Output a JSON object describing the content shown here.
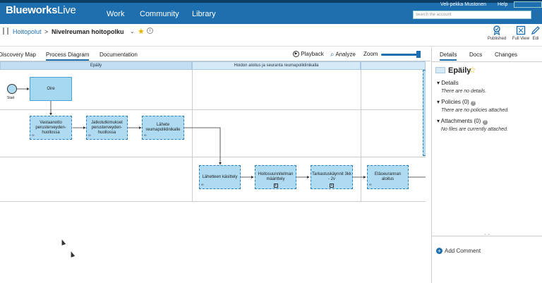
{
  "header": {
    "logo_bold": "Blueworks",
    "logo_light": "Live",
    "nav": [
      "Work",
      "Community",
      "Library"
    ],
    "user": "Veli-pekka Mustonen",
    "help": "Help",
    "search_placeholder": "search the account"
  },
  "breadcrumb": {
    "parent": "Hoitopolut",
    "separator": ">",
    "current": "Nivelreuman hoitopolku",
    "chevron": "⌄",
    "star": "★",
    "info": "i"
  },
  "toolbar_buttons": [
    {
      "label": "Published",
      "icon": "award-icon"
    },
    {
      "label": "Full View",
      "icon": "fullview-icon"
    },
    {
      "label": "Edi",
      "icon": "edit-icon"
    }
  ],
  "tabs": [
    "Discovery Map",
    "Process Diagram",
    "Documentation"
  ],
  "controls": {
    "playback": "Playback",
    "analyze": "Analyze",
    "zoom": "Zoom",
    "zoom_level": 0.95
  },
  "lanes": [
    {
      "title": "Epäily"
    },
    {
      "title": "Hoidon aloitus ja seuranta reumapoliklinikalla"
    },
    {
      "title": ""
    }
  ],
  "start_label": "Start",
  "tasks": [
    {
      "label": "Oire",
      "marker": ""
    },
    {
      "label": "Vastaanotto perusterveyden-huollossa",
      "marker": "∞"
    },
    {
      "label": "Jatkotutkimukset perusterveyden-huollossa",
      "marker": "∞"
    },
    {
      "label": "Lähete reumapoliklinikalle",
      "marker": "∞"
    },
    {
      "label": "Lähetteen käsittely",
      "marker": "∞"
    },
    {
      "label": "Hoitosuunnitelman määrittely",
      "marker": "+"
    },
    {
      "label": "Tarkastuskäynnit 3kk - 2v",
      "marker": "+"
    },
    {
      "label": "Etäseurannan aloitus",
      "marker": "∞"
    }
  ],
  "right_panel": {
    "tabs": [
      "Details",
      "Docs",
      "Changes"
    ],
    "selected_title": "Epäily",
    "sections": [
      {
        "title": "Details",
        "body": "There are no details.",
        "info": false
      },
      {
        "title": "Policies (0)",
        "body": "There are no policies attached.",
        "info": true
      },
      {
        "title": "Attachments (0)",
        "body": "No files are currently attached.",
        "info": true
      }
    ],
    "add_comment": "Add Comment"
  },
  "colors": {
    "nav_blue": "#1e6faf",
    "task_fill": "#aedbf2",
    "lane_header": "#d6e9f7",
    "star": "#e8b400"
  }
}
